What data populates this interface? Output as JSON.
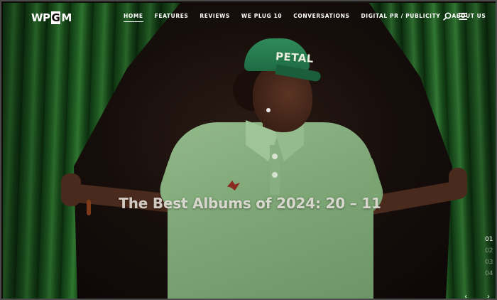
{
  "site": {
    "logo_left": "WP",
    "logo_mid": "G",
    "logo_right": "M"
  },
  "nav": {
    "items": [
      {
        "label": "HOME",
        "active": true
      },
      {
        "label": "FEATURES"
      },
      {
        "label": "REVIEWS"
      },
      {
        "label": "WE PLUG 10"
      },
      {
        "label": "CONVERSATIONS"
      },
      {
        "label": "DIGITAL PR / PUBLICITY"
      },
      {
        "label": "ABOUT US"
      }
    ],
    "search_icon": "search-icon",
    "menu_icon": "hamburger-icon"
  },
  "hero": {
    "headline": "The Best Albums of 2024: 20 – 11",
    "cap_text": "PETAL",
    "curtain_color": "#1f5b22",
    "shirt_color": "#87ae7e"
  },
  "pager": {
    "slides": [
      "01",
      "02",
      "03",
      "04"
    ],
    "active_index": 0,
    "prev_icon": "chevron-left-icon",
    "next_icon": "chevron-right-icon",
    "prev_glyph": "‹",
    "next_glyph": "›"
  }
}
